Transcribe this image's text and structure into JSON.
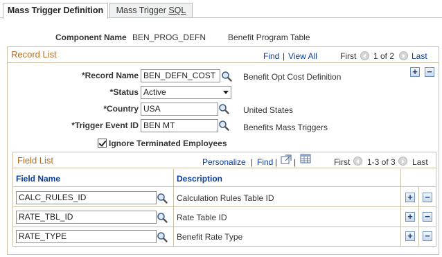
{
  "tabs": [
    {
      "label": "Mass Trigger Definition",
      "active": true
    },
    {
      "label_pre": "Mass Trigger ",
      "label_underline": "SQL",
      "active": false
    }
  ],
  "component": {
    "label": "Component Name",
    "code": "BEN_PROG_DEFN",
    "description": "Benefit Program Table"
  },
  "record_list": {
    "title": "Record List",
    "find": "Find",
    "sep": "|",
    "view_all": "View All",
    "first": "First",
    "position": "1 of 2",
    "last": "Last"
  },
  "fields": {
    "record_name": {
      "label": "*Record Name",
      "value": "BEN_DEFN_COST",
      "description": "Benefit Opt Cost Definition"
    },
    "status": {
      "label": "*Status",
      "value": "Active"
    },
    "country": {
      "label": "*Country",
      "value": "USA",
      "description": "United States"
    },
    "trigger_event": {
      "label": "*Trigger Event ID",
      "value": "BEN MT",
      "description": "Benefits Mass Triggers"
    },
    "ignore_terminated": {
      "label": "Ignore Terminated Employees",
      "checked": true
    }
  },
  "field_list": {
    "title": "Field List",
    "personalize": "Personalize",
    "sep": "|",
    "find": "Find",
    "first": "First",
    "position": "1-3 of 3",
    "last": "Last",
    "col_field_name": "Field Name",
    "col_description": "Description",
    "rows": [
      {
        "field": "CALC_RULES_ID",
        "description": "Calculation Rules Table ID"
      },
      {
        "field": "RATE_TBL_ID",
        "description": "Rate Table ID"
      },
      {
        "field": "RATE_TYPE",
        "description": "Benefit Rate Type"
      }
    ]
  },
  "colors": {
    "section_title": "#b56a1c",
    "link": "#0b3d9c",
    "border": "#cdbfa6"
  },
  "icons": {
    "lookup": "magnifier-icon",
    "add": "plus-icon",
    "delete": "minus-icon",
    "view": "expand-view-icon",
    "download": "grid-download-icon"
  }
}
